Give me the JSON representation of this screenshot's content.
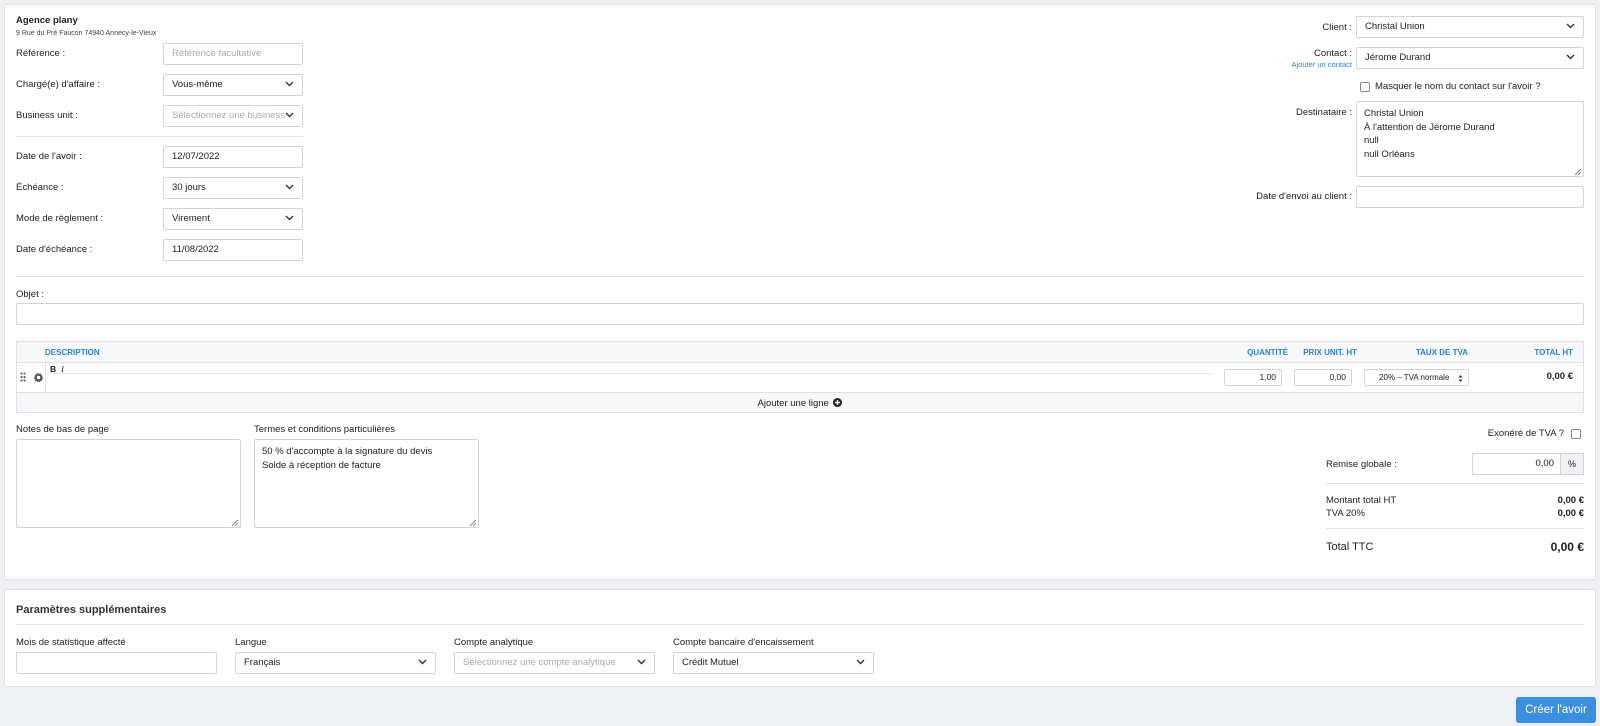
{
  "agency": {
    "name": "Agence plany",
    "address": "9 Rue du Pré Faucon 74940 Annecy-le-Vieux"
  },
  "form_left": {
    "reference": {
      "label": "Référence :",
      "placeholder": "Référence facultative",
      "value": ""
    },
    "charge_affaire": {
      "label": "Chargé(e) d'affaire :",
      "value": "Vous-même"
    },
    "business_unit": {
      "label": "Business unit :",
      "placeholder": "Sélectionnez une business"
    },
    "date_avoir": {
      "label": "Date de l'avoir :",
      "value": "12/07/2022"
    },
    "echeance": {
      "label": "Échéance :",
      "value": "30 jours"
    },
    "mode_reglement": {
      "label": "Mode de règlement :",
      "value": "Virement"
    },
    "date_echeance": {
      "label": "Date d'échéance :",
      "value": "11/08/2022"
    }
  },
  "form_right": {
    "client": {
      "label": "Client :",
      "value": "Christal Union"
    },
    "contact": {
      "label": "Contact :",
      "value": "Jérome Durand",
      "add_link": "Ajouter un contact"
    },
    "masquer": {
      "label": "Masquer le nom du contact sur l'avoir ?"
    },
    "destinataire": {
      "label": "Destinataire :",
      "lines": [
        "Christal Union",
        "À l'attention de Jérome Durand",
        "null",
        "null Orléans"
      ]
    },
    "date_envoi": {
      "label": "Date d'envoi au client :",
      "value": ""
    }
  },
  "objet": {
    "label": "Objet :",
    "value": ""
  },
  "table": {
    "headers": {
      "description": "DESCRIPTION",
      "quantite": "QUANTITÉ",
      "prix": "PRIX UNIT. HT",
      "tva": "TAUX DE TVA",
      "total": "TOTAL HT"
    },
    "row": {
      "bold_btn": "B",
      "italic_btn": "I",
      "quantite": "1,00",
      "prix": "0,00",
      "tva": "20% – TVA normale",
      "total": "0,00 €"
    },
    "add_line": "Ajouter une ligne"
  },
  "notes": {
    "label": "Notes de bas de page",
    "value": ""
  },
  "termes": {
    "label": "Termes et conditions particulières",
    "lines": [
      "50 % d'accompte à la signature du devis",
      "Solde à réception de facture"
    ]
  },
  "totals": {
    "exonere_label": "Exonéré de TVA ?",
    "remise_label": "Remise globale :",
    "remise_value": "0,00",
    "remise_unit": "%",
    "montant_ht_label": "Montant total HT",
    "montant_ht_value": "0,00 €",
    "tva_label": "TVA 20%",
    "tva_value": "0,00 €",
    "ttc_label": "Total TTC",
    "ttc_value": "0,00 €"
  },
  "params": {
    "title": "Paramètres supplémentaires",
    "mois": {
      "label": "Mois de statistique affecté",
      "value": ""
    },
    "langue": {
      "label": "Langue",
      "value": "Français"
    },
    "compte_analytique": {
      "label": "Compte analytique",
      "placeholder": "Sélectionnez une compte analytique"
    },
    "compte_bancaire": {
      "label": "Compte bancaire d'encaissement",
      "value": "Crédit Mutuel"
    }
  },
  "submit": {
    "label": "Créer l'avoir"
  },
  "colors": {
    "accent": "#3a8fde",
    "header_blue": "#2f7fd0",
    "background": "#eef0f3"
  }
}
